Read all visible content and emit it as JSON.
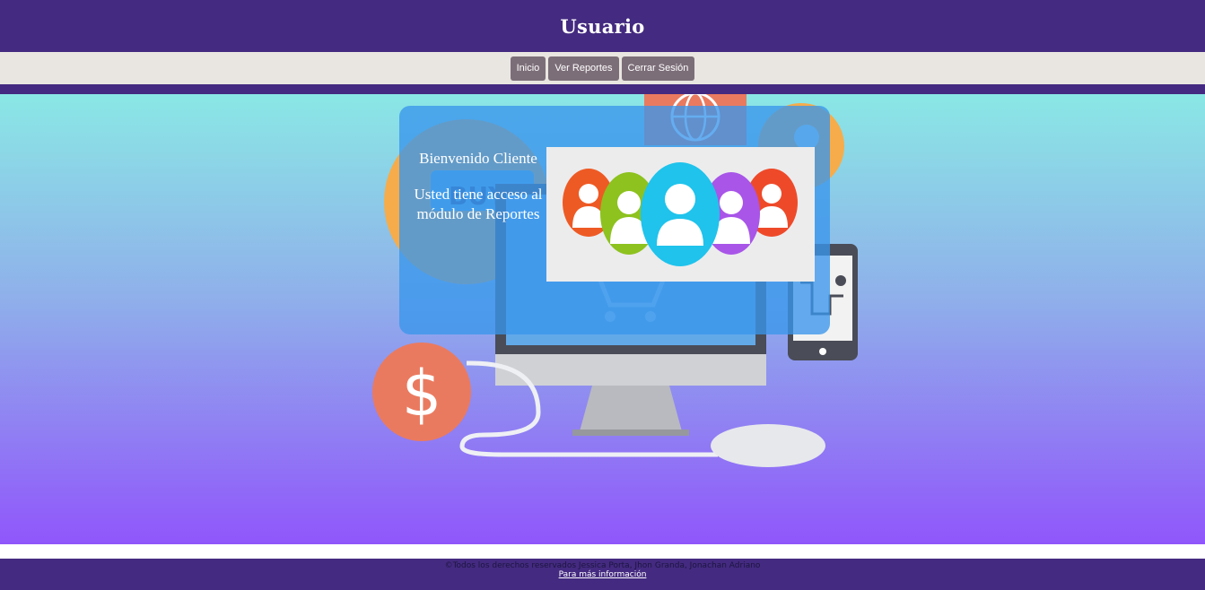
{
  "header": {
    "title": "Usuario"
  },
  "nav": {
    "items": [
      "Inicio",
      "Ver Reportes",
      "Cerrar Sesión"
    ]
  },
  "card": {
    "welcome": "Bienvenido Cliente",
    "message": "Usted tiene acceso al módulo de Reportes"
  },
  "background_art": {
    "icons": [
      "monitor-icon",
      "dollar-coin-icon",
      "smartphone-map-icon",
      "globe-icon",
      "lightbulb-icon",
      "buy-button-icon",
      "shopping-cart-icon",
      "mouse-icon"
    ]
  },
  "users_image": {
    "icons": [
      "user-avatar-orange",
      "user-avatar-green",
      "user-avatar-blue",
      "user-avatar-purple",
      "user-avatar-red"
    ]
  },
  "footer": {
    "copyright": "©Todos los derechos reservados Jessica Porta, Jhon Granda, Jonachan Adriano",
    "more_info": "Para más información"
  },
  "colors": {
    "primary": "#442a80",
    "nav_bg": "#e9e6e1",
    "nav_button": "#7c6e78",
    "card": "#3a96ec"
  }
}
